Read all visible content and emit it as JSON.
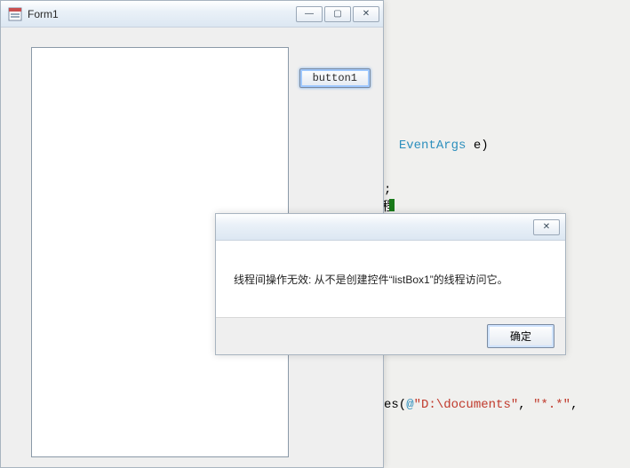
{
  "form": {
    "title": "Form1",
    "button1_label": "button1"
  },
  "dialog": {
    "message": "线程间操作无效: 从不是创建控件“listBox1”的线程访问它。",
    "ok_label": "确定"
  },
  "code": {
    "line1_type": "EventArgs",
    "line1_rest": " e)",
    "line2": ";",
    "line3": "程",
    "line4_prefix": "es(",
    "line4_at": "@",
    "line4_str1": "\"D:\\documents\"",
    "line4_mid": ", ",
    "line4_str2": "\"*.*\""
  },
  "window_buttons": {
    "minimize": "—",
    "maximize": "▢",
    "close": "✕"
  }
}
